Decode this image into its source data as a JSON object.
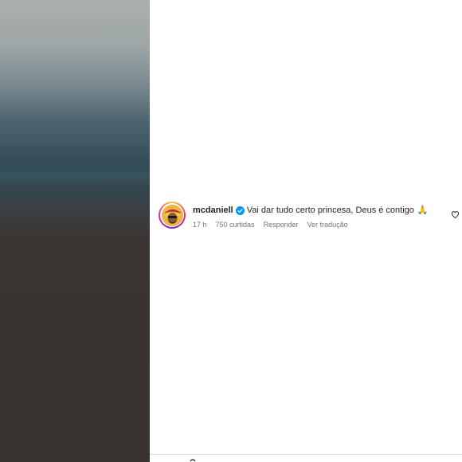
{
  "comment": {
    "username": "mcdaniell",
    "verified_icon": "verified-badge-icon",
    "text": "Vai dar tudo certo princesa, Deus é contigo",
    "emoji": "🙏",
    "time": "17 h",
    "likes": "750 curtidas",
    "reply_label": "Responder",
    "translate_label": "Ver tradução",
    "like_icon": "heart-outline-icon"
  },
  "colors": {
    "verified_blue": "#0095f6",
    "text_primary": "#262626",
    "text_secondary": "#737373"
  }
}
